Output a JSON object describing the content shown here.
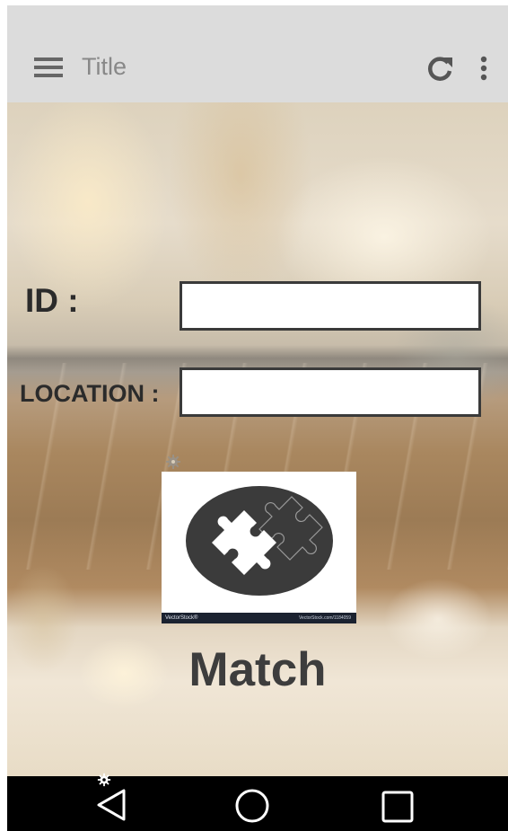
{
  "app_bar": {
    "title": "Title",
    "menu_icon": "hamburger-menu-icon",
    "refresh_icon": "refresh-icon",
    "overflow_icon": "more-vertical-icon",
    "background": "#dcdcdc"
  },
  "form": {
    "id_label": "ID :",
    "id_value": "",
    "location_label": "LOCATION :",
    "location_value": ""
  },
  "match": {
    "image_icon": "puzzle-icon",
    "image_brand": "VectorStock®",
    "image_ref": "VectorStock.com/1184059",
    "label": "Match"
  },
  "nav_bar": {
    "back_icon": "back-triangle-icon",
    "home_icon": "home-circle-icon",
    "recents_icon": "recents-square-icon",
    "background": "#000000"
  },
  "colors": {
    "label_text": "#2b2b2b",
    "match_text": "#3d3d3d",
    "field_border": "#3a3a3a",
    "puzzle_disc": "#3b3b3b"
  }
}
